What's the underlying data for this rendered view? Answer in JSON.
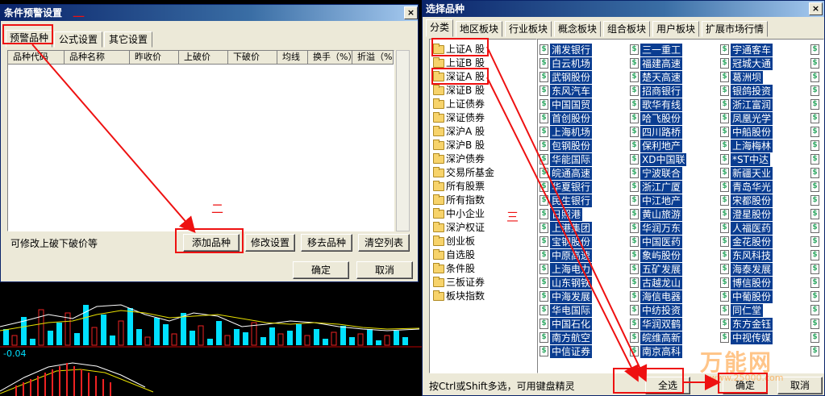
{
  "left_dialog": {
    "title": "条件预警设置",
    "tabs": [
      "预警品种",
      "公式设置",
      "其它设置"
    ],
    "columns": [
      "品种代码",
      "品种名称",
      "昨收价",
      "上破价",
      "下破价",
      "均线",
      "换手（%）",
      "折溢（%）"
    ],
    "hint": "可修改上破下破价等",
    "buttons": {
      "add": "添加品种",
      "modify": "修改设置",
      "remove": "移去品种",
      "clear": "清空列表"
    },
    "ok": "确定",
    "cancel": "取消",
    "close": "×"
  },
  "right_dialog": {
    "title": "选择品种",
    "close": "×",
    "tabs": [
      "分类",
      "地区板块",
      "行业板块",
      "概念板块",
      "组合板块",
      "用户板块",
      "扩展市场行情"
    ],
    "categories": [
      "上证A 股",
      "上证B 股",
      "深证A 股",
      "深证B 股",
      "上证债券",
      "深证债券",
      "深沪A 股",
      "深沪B 股",
      "深沪债券",
      "交易所基金",
      "所有股票",
      "所有指数",
      "中小企业",
      "深沪权证",
      "创业板",
      "自选股",
      "条件股",
      "三板证券",
      "板块指数"
    ],
    "stock_columns": [
      [
        "浦发银行",
        "白云机场",
        "武钢股份",
        "东风汽车",
        "中国国贸",
        "首创股份",
        "上海机场",
        "包钢股份",
        "华能国际",
        "皖通高速",
        "华夏银行",
        "民生银行",
        "日照港",
        "上港集团",
        "宝钢股份",
        "中原高速",
        "上海电力",
        "山东钢铁",
        "中海发展",
        "华电国际",
        "中国石化",
        "南方航空",
        "中信证券"
      ],
      [
        "三一重工",
        "福建高速",
        "楚天高速",
        "招商银行",
        "歌华有线",
        "哈飞股份",
        "四川路桥",
        "保利地产",
        "XD中国联",
        "宁波联合",
        "浙江广厦",
        "中江地产",
        "黄山旅游",
        "华润万东",
        "中国医药",
        "象屿股份",
        "五矿发展",
        "古越龙山",
        "海信电器",
        "中纺投资",
        "华润双鹤",
        "皖维高新",
        "南京高科"
      ],
      [
        "宇通客车",
        "冠城大通",
        "葛洲坝",
        "银鸽投资",
        "浙江富润",
        "凤凰光学",
        "中船股份",
        "上海梅林",
        "*ST中达",
        "新疆天业",
        "青岛华光",
        "宋都股份",
        "澄星股份",
        "人福医药",
        "金花股份",
        "东风科技",
        "海泰发展",
        "博信股份",
        "中葡股份",
        "同仁堂",
        "东方金钰",
        "中视传媒",
        ""
      ]
    ],
    "status": "按Ctrl或Shift多选，可用键盘精灵",
    "buttons": {
      "select_all": "全选",
      "ok": "确定",
      "cancel": "取消"
    }
  },
  "chart": {
    "value_label": "-0.04"
  },
  "annotations": {
    "one": "一",
    "two": "二",
    "three": "三"
  },
  "watermark": {
    "brand": "万能网",
    "site": "www.25000.com"
  },
  "colors": {
    "accent_red": "#e11111",
    "selected_blue": "#0a3d91",
    "bar_cyan": "#00e0ff"
  }
}
